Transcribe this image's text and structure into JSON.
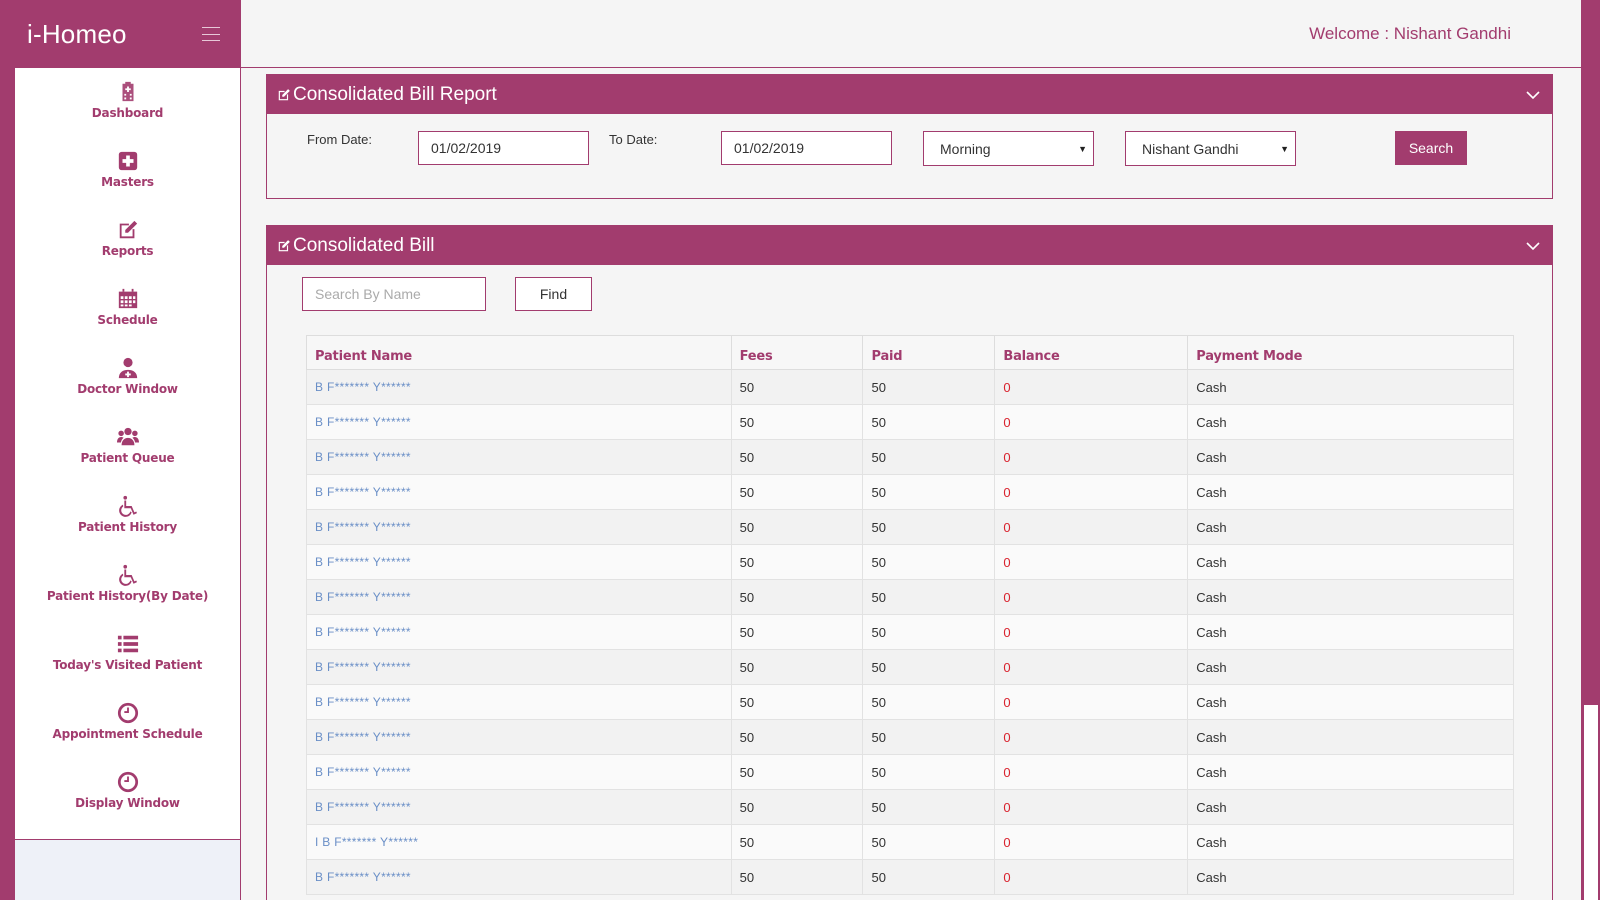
{
  "app": {
    "brand": "i-Homeo"
  },
  "header": {
    "welcome": "Welcome : Nishant Gandhi"
  },
  "sidebar": {
    "items": [
      {
        "label": "Dashboard",
        "icon": "hospital-icon"
      },
      {
        "label": "Masters",
        "icon": "plus-square-icon"
      },
      {
        "label": "Reports",
        "icon": "edit-icon"
      },
      {
        "label": "Schedule",
        "icon": "calendar-icon"
      },
      {
        "label": "Doctor Window",
        "icon": "doctor-icon"
      },
      {
        "label": "Patient Queue",
        "icon": "users-icon"
      },
      {
        "label": "Patient History",
        "icon": "wheelchair-icon"
      },
      {
        "label": "Patient History(By Date)",
        "icon": "wheelchair-icon"
      },
      {
        "label": "Today's Visited Patient",
        "icon": "list-icon"
      },
      {
        "label": "Appointment Schedule",
        "icon": "clock-icon"
      },
      {
        "label": "Display Window",
        "icon": "clock-icon"
      }
    ]
  },
  "report_panel": {
    "title": "Consolidated Bill Report",
    "from_label": "From Date:",
    "from_value": "01/02/2019",
    "to_label": "To Date:",
    "to_value": "01/02/2019",
    "shift_selected": "Morning",
    "doctor_selected": "Nishant Gandhi",
    "search_label": "Search"
  },
  "bill_panel": {
    "title": "Consolidated Bill",
    "search_placeholder": "Search By Name",
    "find_label": "Find",
    "columns": [
      "Patient Name",
      "Fees",
      "Paid",
      "Balance",
      "Payment Mode"
    ],
    "rows": [
      {
        "name": "B F******* Y******",
        "fees": "50",
        "paid": "50",
        "balance": "0",
        "mode": "Cash"
      },
      {
        "name": "B F******* Y******",
        "fees": "50",
        "paid": "50",
        "balance": "0",
        "mode": "Cash"
      },
      {
        "name": "B F******* Y******",
        "fees": "50",
        "paid": "50",
        "balance": "0",
        "mode": "Cash"
      },
      {
        "name": "B F******* Y******",
        "fees": "50",
        "paid": "50",
        "balance": "0",
        "mode": "Cash"
      },
      {
        "name": "B F******* Y******",
        "fees": "50",
        "paid": "50",
        "balance": "0",
        "mode": "Cash"
      },
      {
        "name": "B F******* Y******",
        "fees": "50",
        "paid": "50",
        "balance": "0",
        "mode": "Cash"
      },
      {
        "name": "B F******* Y******",
        "fees": "50",
        "paid": "50",
        "balance": "0",
        "mode": "Cash"
      },
      {
        "name": "B F******* Y******",
        "fees": "50",
        "paid": "50",
        "balance": "0",
        "mode": "Cash"
      },
      {
        "name": "B F******* Y******",
        "fees": "50",
        "paid": "50",
        "balance": "0",
        "mode": "Cash"
      },
      {
        "name": "B F******* Y******",
        "fees": "50",
        "paid": "50",
        "balance": "0",
        "mode": "Cash"
      },
      {
        "name": "B F******* Y******",
        "fees": "50",
        "paid": "50",
        "balance": "0",
        "mode": "Cash"
      },
      {
        "name": "B F******* Y******",
        "fees": "50",
        "paid": "50",
        "balance": "0",
        "mode": "Cash"
      },
      {
        "name": "B F******* Y******",
        "fees": "50",
        "paid": "50",
        "balance": "0",
        "mode": "Cash"
      },
      {
        "name": "I B F******* Y******",
        "fees": "50",
        "paid": "50",
        "balance": "0",
        "mode": "Cash"
      },
      {
        "name": "B F******* Y******",
        "fees": "50",
        "paid": "50",
        "balance": "0",
        "mode": "Cash"
      }
    ]
  },
  "colors": {
    "accent": "#a23c6e",
    "link": "#6a8fc7",
    "balance": "#d9232e"
  }
}
